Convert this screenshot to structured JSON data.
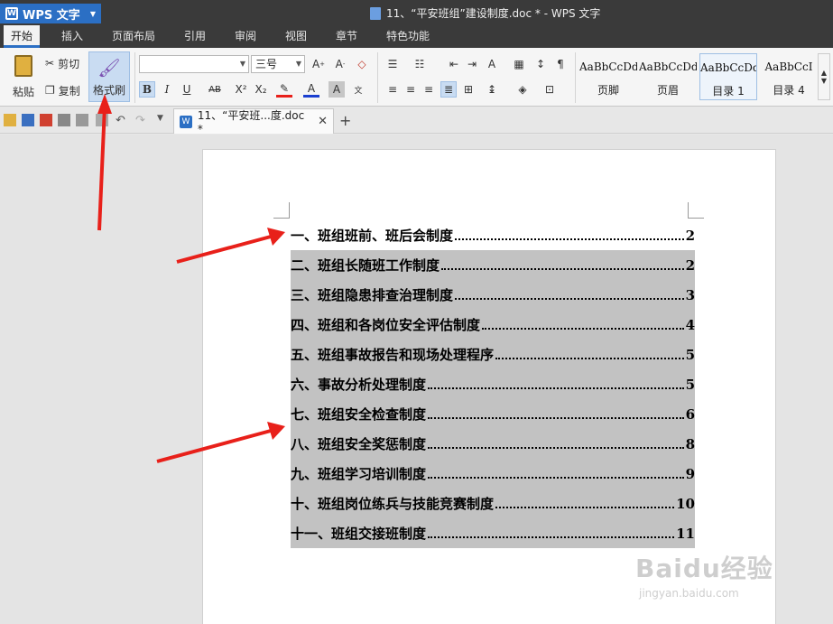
{
  "app": {
    "name": "WPS 文字",
    "title": "11、“平安班组”建设制度.doc * - WPS 文字"
  },
  "menu": {
    "tabs": [
      "开始",
      "插入",
      "页面布局",
      "引用",
      "审阅",
      "视图",
      "章节",
      "特色功能"
    ],
    "active": "开始"
  },
  "ribbon": {
    "paste_label": "粘贴",
    "cut_label": "剪切",
    "copy_label": "复制",
    "format_painter_label": "格式刷",
    "font_name_value": "",
    "font_size_value": "三号",
    "bold": "B",
    "italic": "I",
    "underline": "U",
    "strike": "AB",
    "superscript": "X²",
    "subscript": "X₂",
    "styles": [
      {
        "preview": "AaBbCcDd",
        "name": "页脚"
      },
      {
        "preview": "AaBbCcDd",
        "name": "页眉"
      },
      {
        "preview": "AaBbCcDd",
        "name": "目录 1"
      },
      {
        "preview": "AaBbCcI",
        "name": "目录 4"
      }
    ]
  },
  "doc_tab": {
    "label": "11、“平安班...度.doc *"
  },
  "toc": [
    {
      "title": "一、班组班前、班后会制度",
      "page": "2"
    },
    {
      "title": "二、班组长随班工作制度",
      "page": "2"
    },
    {
      "title": "三、班组隐患排查治理制度",
      "page": "3"
    },
    {
      "title": "四、班组和各岗位安全评估制度",
      "page": "4"
    },
    {
      "title": "五、班组事故报告和现场处理程序",
      "page": "5"
    },
    {
      "title": "六、事故分析处理制度",
      "page": "5"
    },
    {
      "title": "七、班组安全检查制度",
      "page": "6"
    },
    {
      "title": "八、班组安全奖惩制度",
      "page": "8"
    },
    {
      "title": "九、班组学习培训制度",
      "page": "9"
    },
    {
      "title": "十、班组岗位练兵与技能竞赛制度",
      "page": "10"
    },
    {
      "title": "十一、班组交接班制度",
      "page": "11"
    }
  ],
  "watermark": {
    "brand": "Baidu经验",
    "url": "jingyan.baidu.com"
  },
  "colors": {
    "accent": "#2b6fc4",
    "arrow": "#e8201a",
    "highlight": "#c2c2c2"
  }
}
